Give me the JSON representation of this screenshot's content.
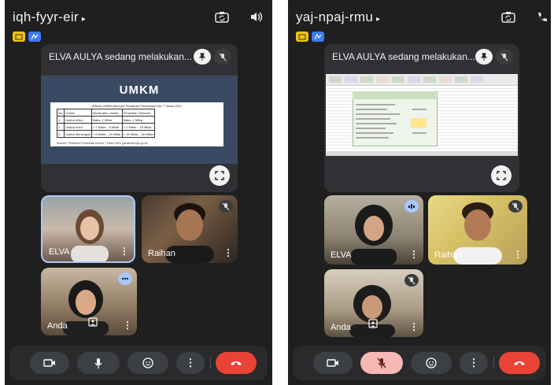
{
  "left": {
    "meeting_code": "iqh-fyyr-eir",
    "presenter_caption": "ELVA AULYA sedang melakukan...",
    "slide": {
      "heading": "UMKM",
      "table_title": "Kriteria UMKM Menurut Peraturan Pemerintah No. 7 Tahun 2021",
      "rows": [
        [
          "No.",
          "Uraian",
          "Modal atau Usaha",
          "Penjualan Tahunan"
        ],
        [
          "1",
          "Usaha Mikro",
          "Maks. 1 Miliar",
          "Maks. 2 Miliar"
        ],
        [
          "2",
          "Usaha Kecil",
          "> 1 Miliar – 5 Miliar",
          "> 2 Miliar – 15 Miliar"
        ],
        [
          "3",
          "Usaha Menengah",
          "> 5 Miliar – 10 Miliar",
          "> 15 Miliar – 50 Miliar"
        ]
      ],
      "source": "Sumber: Peraturan Pemerintah Nomor 7 Tahun 2021 (peraturan.bpk.go.id)"
    },
    "tiles": [
      {
        "name": "ELVA"
      },
      {
        "name": "Raihan"
      },
      {
        "name": "Anda"
      }
    ]
  },
  "right": {
    "meeting_code": "yaj-npaj-rmu",
    "presenter_caption": "ELVA AULYA sedang melakukan...",
    "tiles": [
      {
        "name": "ELVA"
      },
      {
        "name": "Raihan"
      },
      {
        "name": "Anda"
      }
    ]
  },
  "icons": {
    "caret": "▸",
    "more": "⋮"
  },
  "colors": {
    "end_call": "#ea4335",
    "mic_muted_bg": "#f6b8b5",
    "badge_yellow": "#f5c518",
    "badge_blue": "#3b7cf5",
    "active_speaker_border": "#a8c7fa"
  }
}
